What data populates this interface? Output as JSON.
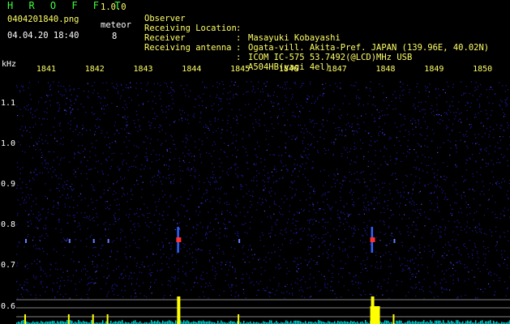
{
  "header": {
    "app_title": "H R O F F T",
    "app_version": "1.0.0",
    "filename": "0404201840.png",
    "datetime": "04.04.20 18:40",
    "meteor_label": "meteor",
    "meteor_count": "8"
  },
  "info": [
    {
      "key": "Observer",
      "value": "Masayuki Kobayashi"
    },
    {
      "key": "Receiving Location",
      "value": "Ogata-vill. Akita-Pref. JAPAN (139.96E, 40.02N)"
    },
    {
      "key": "Receiver",
      "value": "ICOM IC-575 53.7492(@LCD)MHz USB"
    },
    {
      "key": "Receiving antenna",
      "value": "A504HB(yagi 4el)"
    }
  ],
  "info_colon": ":",
  "axis": {
    "unit": "kHz",
    "x_ticks": [
      "1841",
      "1842",
      "1843",
      "1844",
      "1845",
      "1846",
      "1847",
      "1848",
      "1849",
      "1850"
    ],
    "y_ticks": [
      "1.1",
      "1.0",
      "0.9",
      "0.8",
      "0.7",
      "0.6"
    ]
  },
  "colors": {
    "background": "#000000",
    "noise": "#1a1aa0",
    "echo": "#ff3030",
    "histogram": "#ffff00",
    "baseline": "#00d0d0",
    "grid_line": "#b0b0b0"
  },
  "chart_data": {
    "type": "heatmap",
    "x_ticks": [
      "1841",
      "1842",
      "1843",
      "1844",
      "1845",
      "1846",
      "1847",
      "1848",
      "1849",
      "1850"
    ],
    "y_ticks": [
      "1.1",
      "1.0",
      "0.9",
      "0.8",
      "0.7",
      "0.6"
    ],
    "ylabel": "kHz",
    "meteor_echo_minutes": [
      1840.6,
      1841.5,
      1842.0,
      1842.3,
      1843.75,
      1845.0,
      1847.75,
      1848.2
    ],
    "strong_echo_minutes": [
      1843.75,
      1847.75
    ],
    "echo_frequency_khz": 0.76
  }
}
